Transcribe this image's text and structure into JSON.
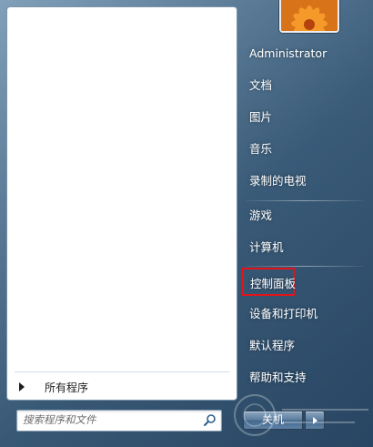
{
  "user": {
    "name": "Administrator"
  },
  "left": {
    "all_programs_label": "所有程序",
    "search_placeholder": "搜索程序和文件"
  },
  "right": {
    "items": [
      {
        "label": "文档"
      },
      {
        "label": "图片"
      },
      {
        "label": "音乐"
      },
      {
        "label": "录制的电视"
      },
      {
        "label": "游戏"
      },
      {
        "label": "计算机"
      },
      {
        "label": "控制面板"
      },
      {
        "label": "设备和打印机"
      },
      {
        "label": "默认程序"
      },
      {
        "label": "帮助和支持"
      }
    ]
  },
  "shutdown": {
    "label": "关机"
  },
  "colors": {
    "highlight_border": "#e2141b",
    "menu_text": "#ffffff"
  }
}
